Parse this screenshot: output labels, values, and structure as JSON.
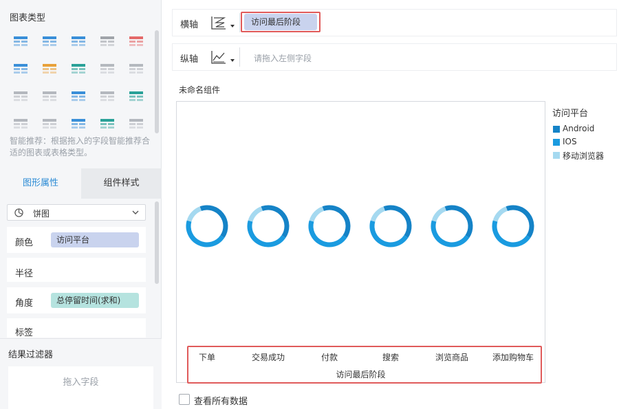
{
  "left_panel": {
    "chart_types_title": "图表类型",
    "chart_type_icons": [
      "table-icon",
      "grouped-table-icon",
      "cross-table-icon",
      "kpi-number-icon",
      "colored-kpi-icon",
      "map-dots-icon",
      "heatmap-icon",
      "scatter-grid-icon",
      "bar-mini-icon",
      "bar-tall-icon",
      "waterfall-icon",
      "step-bar-icon",
      "wave-line-icon",
      "radar-line-icon",
      "radar-polygon-icon",
      "area-line-icon",
      "stacked-bar-icon",
      "scatter-icon",
      "bubble-ring-icon",
      "pie-icon"
    ],
    "smart_hint": "智能推荐：根据拖入的字段智能推荐合适的图表或表格类型。",
    "tabs": {
      "shape_props": "图形属性",
      "component_style": "组件样式"
    },
    "chart_type_select": "饼图",
    "props": {
      "color_label": "颜色",
      "color_field": "访问平台",
      "radius_label": "半径",
      "angle_label": "角度",
      "angle_field": "总停留时间(求和)",
      "label_label": "标签"
    },
    "filter": {
      "title": "结果过滤器",
      "drop_hint": "拖入字段"
    }
  },
  "axes": {
    "x_label": "横轴",
    "x_field": "访问最后阶段",
    "y_label": "纵轴",
    "y_placeholder": "请拖入左侧字段"
  },
  "widget": {
    "name": "未命名组件"
  },
  "chart_data": {
    "type": "pie",
    "categories": [
      "下单",
      "交易成功",
      "付款",
      "搜索",
      "浏览商品",
      "添加购物车"
    ],
    "xlabel": "访问最后阶段",
    "legend_title": "访问平台",
    "legend_position": "right",
    "series": [
      {
        "name": "Android",
        "color": "#1583c7",
        "values": [
          0.4,
          0.4,
          0.4,
          0.4,
          0.4,
          0.4
        ]
      },
      {
        "name": "IOS",
        "color": "#1a9be0",
        "values": [
          0.45,
          0.45,
          0.45,
          0.45,
          0.45,
          0.45
        ]
      },
      {
        "name": "移动浏览器",
        "color": "#a5d9f0",
        "values": [
          0.15,
          0.15,
          0.15,
          0.15,
          0.15,
          0.15
        ]
      }
    ]
  },
  "footer": {
    "view_all_label": "查看所有数据"
  },
  "colors": {
    "accent": "#2b8bd5",
    "highlight_border": "#e05a5a",
    "pill_blue": "#c9d3ee",
    "pill_teal": "#b5e3df"
  }
}
